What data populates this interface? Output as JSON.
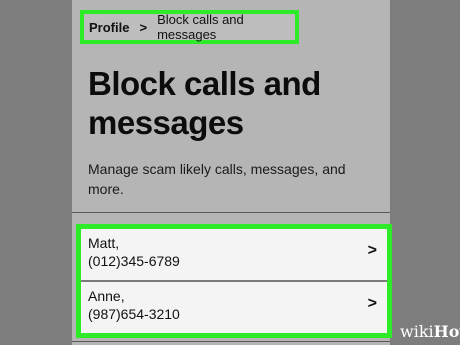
{
  "breadcrumb": {
    "parent": "Profile",
    "separator": ">",
    "current": "Block calls and messages"
  },
  "page": {
    "title_line1": "Block calls and",
    "title_line2": "messages",
    "description_line1": "Manage scam likely calls, messages, and",
    "description_line2": "more."
  },
  "blocked_list": [
    {
      "name": "Matt,",
      "number": "(012)345-6789",
      "chevron": ">"
    },
    {
      "name": "Anne,",
      "number": "(987)654-3210",
      "chevron": ">"
    }
  ],
  "watermark": {
    "part1": "wiki",
    "part2": "How"
  },
  "colors": {
    "highlight": "#2eeb2a",
    "screen_bg": "#b5b5b5",
    "side_bg": "#7d7d7d",
    "list_bg": "#f4f4f4"
  }
}
